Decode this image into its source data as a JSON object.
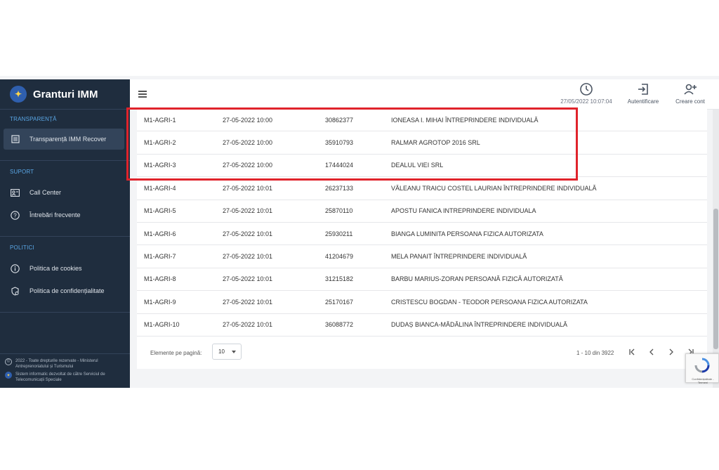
{
  "brand": {
    "title": "Granturi IMM"
  },
  "sidebar": {
    "sections": [
      {
        "label": "TRANSPARENȚĂ",
        "items": [
          {
            "label": "Transparență IMM Recover",
            "icon": "list-icon"
          }
        ]
      },
      {
        "label": "SUPORT",
        "items": [
          {
            "label": "Call Center",
            "icon": "contact-card-icon"
          },
          {
            "label": "Întrebări frecvente",
            "icon": "help-circle-icon"
          }
        ]
      },
      {
        "label": "POLITICI",
        "items": [
          {
            "label": "Politica de cookies",
            "icon": "info-icon"
          },
          {
            "label": "Politica de confidențialitate",
            "icon": "privacy-icon"
          }
        ]
      }
    ],
    "footer": {
      "copyright": "2022 - Toate drepturile rezervate - Ministerul Antreprenoriatului și Turismului",
      "developer": "Sistem informatic dezvoltat de către Serviciul de Telecomunicații Speciale"
    }
  },
  "header": {
    "datetime": "27/05/2022 10:07:04",
    "login_label": "Autentificare",
    "signup_label": "Creare cont"
  },
  "table": {
    "rows": [
      {
        "code": "M1-AGRI-1",
        "date": "27-05-2022 10:00",
        "id": "30862377",
        "name": "IONEASA I. MIHAI ÎNTREPRINDERE INDIVIDUALĂ"
      },
      {
        "code": "M1-AGRI-2",
        "date": "27-05-2022 10:00",
        "id": "35910793",
        "name": "RALMAR AGROTOP 2016 SRL"
      },
      {
        "code": "M1-AGRI-3",
        "date": "27-05-2022 10:00",
        "id": "17444024",
        "name": "DEALUL VIEI SRL"
      },
      {
        "code": "M1-AGRI-4",
        "date": "27-05-2022 10:01",
        "id": "26237133",
        "name": "VĂLEANU TRAICU COSTEL LAURIAN ÎNTREPRINDERE INDIVIDUALĂ"
      },
      {
        "code": "M1-AGRI-5",
        "date": "27-05-2022 10:01",
        "id": "25870110",
        "name": "APOSTU FANICA INTREPRINDERE INDIVIDUALA"
      },
      {
        "code": "M1-AGRI-6",
        "date": "27-05-2022 10:01",
        "id": "25930211",
        "name": "BIANGA LUMINITA PERSOANA FIZICA AUTORIZATA"
      },
      {
        "code": "M1-AGRI-7",
        "date": "27-05-2022 10:01",
        "id": "41204679",
        "name": "MELA PANAIT ÎNTREPRINDERE INDIVIDUALĂ"
      },
      {
        "code": "M1-AGRI-8",
        "date": "27-05-2022 10:01",
        "id": "31215182",
        "name": "BARBU MARIUS-ZORAN PERSOANĂ FIZICĂ AUTORIZATĂ"
      },
      {
        "code": "M1-AGRI-9",
        "date": "27-05-2022 10:01",
        "id": "25170167",
        "name": "CRISTESCU BOGDAN - TEODOR PERSOANA FIZICA AUTORIZATA"
      },
      {
        "code": "M1-AGRI-10",
        "date": "27-05-2022 10:01",
        "id": "36088772",
        "name": "DUDAȘ BIANCA-MĂDĂLINA ÎNTREPRINDERE INDIVIDUALĂ"
      }
    ]
  },
  "pagination": {
    "label": "Elemente pe pagină:",
    "page_size": "10",
    "range": "1 - 10 din 3922"
  },
  "recaptcha": {
    "text": "Confidențialitate - Termeni"
  },
  "colors": {
    "sidebar_bg": "#1f2d3e",
    "accent": "#5aa7e6",
    "highlight_border": "#e0232b"
  }
}
